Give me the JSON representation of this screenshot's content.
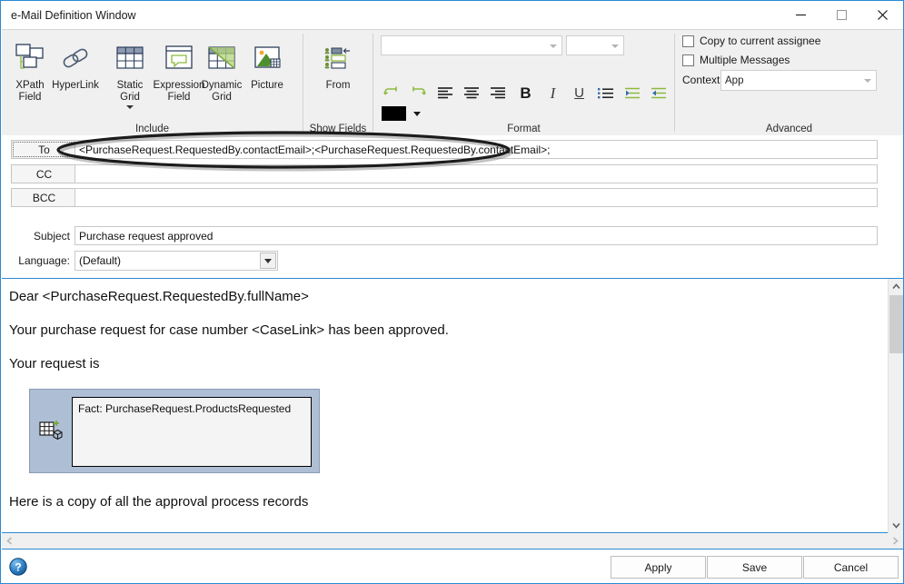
{
  "window": {
    "title": "e-Mail Definition Window",
    "controls": {
      "minimize": "minimize-icon",
      "maximize": "maximize-icon",
      "close": "close-icon"
    }
  },
  "ribbon": {
    "groups": [
      {
        "name": "include",
        "label": "Include"
      },
      {
        "name": "show_fields",
        "label": "Show Fields"
      },
      {
        "name": "format",
        "label": "Format"
      },
      {
        "name": "advanced",
        "label": "Advanced"
      }
    ],
    "include": {
      "buttons": [
        {
          "name": "xpath-field",
          "label": "XPath\nField",
          "icon": "xpath-field-icon",
          "has_menu": false
        },
        {
          "name": "hyperlink",
          "label": "HyperLink",
          "icon": "hyperlink-icon",
          "has_menu": false
        },
        {
          "name": "static-grid",
          "label": "Static\nGrid",
          "icon": "static-grid-icon",
          "has_menu": true
        },
        {
          "name": "expression-field",
          "label": "Expression\nField",
          "icon": "expression-field-icon",
          "has_menu": false
        },
        {
          "name": "dynamic-grid",
          "label": "Dynamic\nGrid",
          "icon": "dynamic-grid-icon",
          "has_menu": false
        },
        {
          "name": "picture",
          "label": "Picture",
          "icon": "picture-icon",
          "has_menu": false
        }
      ]
    },
    "show_fields": {
      "buttons": [
        {
          "name": "from",
          "label": "From",
          "icon": "from-fields-icon"
        }
      ]
    },
    "format": {
      "font_family": {
        "value": "",
        "icon": "chevron-down-icon"
      },
      "font_size": {
        "value": "",
        "icon": "chevron-down-icon"
      },
      "buttons": [
        {
          "name": "undo",
          "icon": "undo-icon",
          "glyph": "↶"
        },
        {
          "name": "redo",
          "icon": "redo-icon",
          "glyph": "↷"
        },
        {
          "name": "align-left",
          "icon": "align-left-icon",
          "glyph": ""
        },
        {
          "name": "align-center",
          "icon": "align-center-icon",
          "glyph": ""
        },
        {
          "name": "align-right",
          "icon": "align-right-icon",
          "glyph": ""
        },
        {
          "name": "bold",
          "icon": "bold-icon",
          "glyph": "B"
        },
        {
          "name": "italic",
          "icon": "italic-icon",
          "glyph": "I"
        },
        {
          "name": "underline",
          "icon": "underline-icon",
          "glyph": "U"
        },
        {
          "name": "bullet-list",
          "icon": "bullet-list-icon",
          "glyph": ""
        },
        {
          "name": "indent-increase",
          "icon": "indent-increase-icon",
          "glyph": ""
        },
        {
          "name": "indent-decrease",
          "icon": "indent-decrease-icon",
          "glyph": ""
        }
      ],
      "text_color": "#000000",
      "text_color_icon": "text-color-icon"
    },
    "advanced": {
      "copy_to_assignee": {
        "label": "Copy to current assignee",
        "checked": false
      },
      "multiple_messages": {
        "label": "Multiple Messages",
        "checked": false
      },
      "context_label": "Context",
      "context_value": "App"
    }
  },
  "address": {
    "to": {
      "button": "To",
      "value": "<PurchaseRequest.RequestedBy.contactEmail>;<PurchaseRequest.RequestedBy.contactEmail>;",
      "highlighted": true
    },
    "cc": {
      "button": "CC",
      "value": ""
    },
    "bcc": {
      "button": "BCC",
      "value": ""
    }
  },
  "meta": {
    "subject_label": "Subject",
    "subject_value": "Purchase request approved",
    "language_label": "Language:",
    "language_value": "(Default)"
  },
  "body": {
    "paragraphs": [
      "Dear <PurchaseRequest.RequestedBy.fullName>",
      "Your purchase request for case number <CaseLink> has been approved.",
      "Your request is"
    ],
    "grid_control": {
      "icon": "dynamic-grid-insert-icon",
      "text": "Fact: PurchaseRequest.ProductsRequested"
    },
    "trailing_paragraph": "Here is a copy of all the approval process records"
  },
  "scrollbars": {
    "vertical": {
      "up": "scroll-up-icon",
      "down": "scroll-down-icon"
    },
    "horizontal": {
      "left": "scroll-left-icon",
      "right": "scroll-right-icon"
    }
  },
  "footer": {
    "help": "help-icon",
    "apply": "Apply",
    "save": "Save",
    "cancel": "Cancel"
  },
  "colors": {
    "accent_border": "#2a8ad4",
    "ribbon_bg": "#f0f0f0",
    "grid_control_bg": "#aebed5",
    "icon_green": "#8cba3f",
    "icon_navy": "#2c3e5a"
  }
}
